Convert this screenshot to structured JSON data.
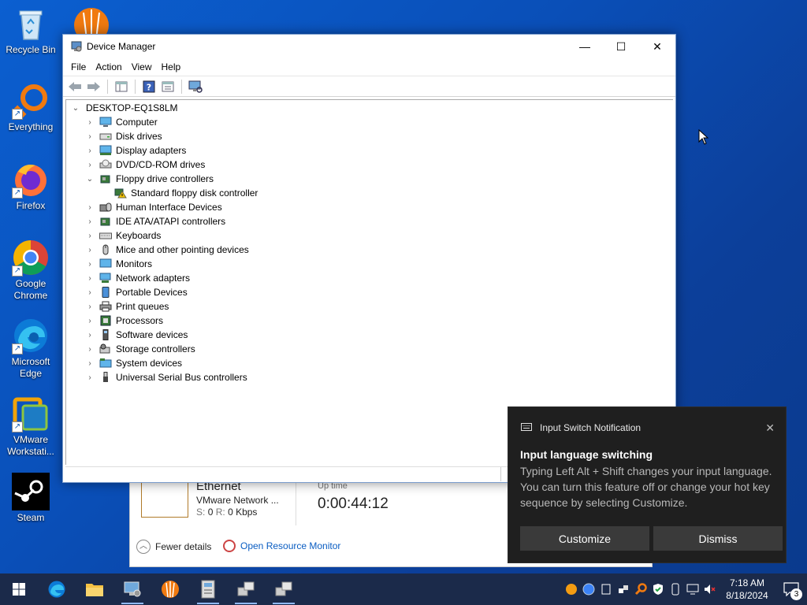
{
  "desktop": {
    "icons": [
      {
        "label": "Recycle Bin",
        "icon": "recycle-bin-icon"
      },
      {
        "label": "Everything",
        "icon": "everything-search-icon"
      },
      {
        "label": "Firefox",
        "icon": "firefox-icon"
      },
      {
        "label": "Google Chrome",
        "icon": "chrome-icon"
      },
      {
        "label": "Microsoft Edge",
        "icon": "edge-icon"
      },
      {
        "label": "VMware Workstati...",
        "icon": "vmware-icon"
      },
      {
        "label": "Steam",
        "icon": "steam-icon"
      }
    ]
  },
  "window": {
    "title": "Device Manager",
    "minimize": "—",
    "maximize": "☐",
    "close": "✕",
    "menu": [
      "File",
      "Action",
      "View",
      "Help"
    ],
    "tree": {
      "root": "DESKTOP-EQ1S8LM",
      "items": [
        {
          "label": "Computer",
          "expanded": false
        },
        {
          "label": "Disk drives",
          "expanded": false
        },
        {
          "label": "Display adapters",
          "expanded": false
        },
        {
          "label": "DVD/CD-ROM drives",
          "expanded": false
        },
        {
          "label": "Floppy drive controllers",
          "expanded": true
        },
        {
          "label": "Standard floppy disk controller",
          "child": true
        },
        {
          "label": "Human Interface Devices",
          "expanded": false
        },
        {
          "label": "IDE ATA/ATAPI controllers",
          "expanded": false
        },
        {
          "label": "Keyboards",
          "expanded": false
        },
        {
          "label": "Mice and other pointing devices",
          "expanded": false
        },
        {
          "label": "Monitors",
          "expanded": false
        },
        {
          "label": "Network adapters",
          "expanded": false
        },
        {
          "label": "Portable Devices",
          "expanded": false
        },
        {
          "label": "Print queues",
          "expanded": false
        },
        {
          "label": "Processors",
          "expanded": false
        },
        {
          "label": "Software devices",
          "expanded": false
        },
        {
          "label": "Storage controllers",
          "expanded": false
        },
        {
          "label": "System devices",
          "expanded": false
        },
        {
          "label": "Universal Serial Bus controllers",
          "expanded": false
        }
      ]
    }
  },
  "task_manager": {
    "ethernet": "Ethernet",
    "adapter": "VMware Network ...",
    "send_label": "S:",
    "send_value": "0",
    "recv_label": "R:",
    "recv_value": "0 Kbps",
    "uptime_label": "Up time",
    "uptime_value": "0:00:44:12",
    "fewer_details": "Fewer details",
    "open_resource_monitor": "Open Resource Monitor"
  },
  "toast": {
    "app_name": "Input Switch Notification",
    "title": "Input language switching",
    "body": "Typing Left Alt + Shift changes your input language. You can turn this feature off or change your hot key sequence by selecting Customize.",
    "customize": "Customize",
    "dismiss": "Dismiss",
    "close": "✕"
  },
  "taskbar": {
    "time": "7:18 AM",
    "date": "8/18/2024",
    "notification_count": "3"
  }
}
